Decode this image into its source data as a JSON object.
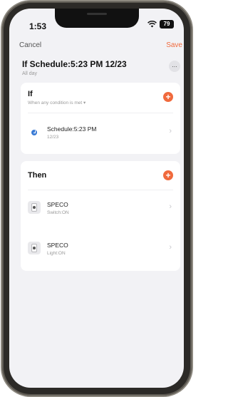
{
  "status_bar": {
    "time": "1:53",
    "battery": "79",
    "wifi_icon": "wifi-icon"
  },
  "nav": {
    "cancel_label": "Cancel",
    "save_label": "Save"
  },
  "header": {
    "title": "If Schedule:5:23 PM 12/23",
    "subtitle": "All day",
    "more_label": "..."
  },
  "if_section": {
    "title": "If",
    "condition_hint": "When any condition is met ▾",
    "add_label": "+",
    "items": [
      {
        "label": "Schedule:5:23 PM",
        "sub": "12/23",
        "icon": "clock-icon"
      }
    ]
  },
  "then_section": {
    "title": "Then",
    "add_label": "+",
    "items": [
      {
        "label": "SPECO",
        "sub": "Switch:ON",
        "icon": "smart-plug-icon"
      },
      {
        "label": "SPECO",
        "sub": "Light:ON",
        "icon": "smart-plug-icon"
      }
    ]
  },
  "chevron": "›",
  "colors": {
    "accent": "#f06a3d",
    "clock": "#3a7bd5",
    "background": "#f2f2f5"
  }
}
